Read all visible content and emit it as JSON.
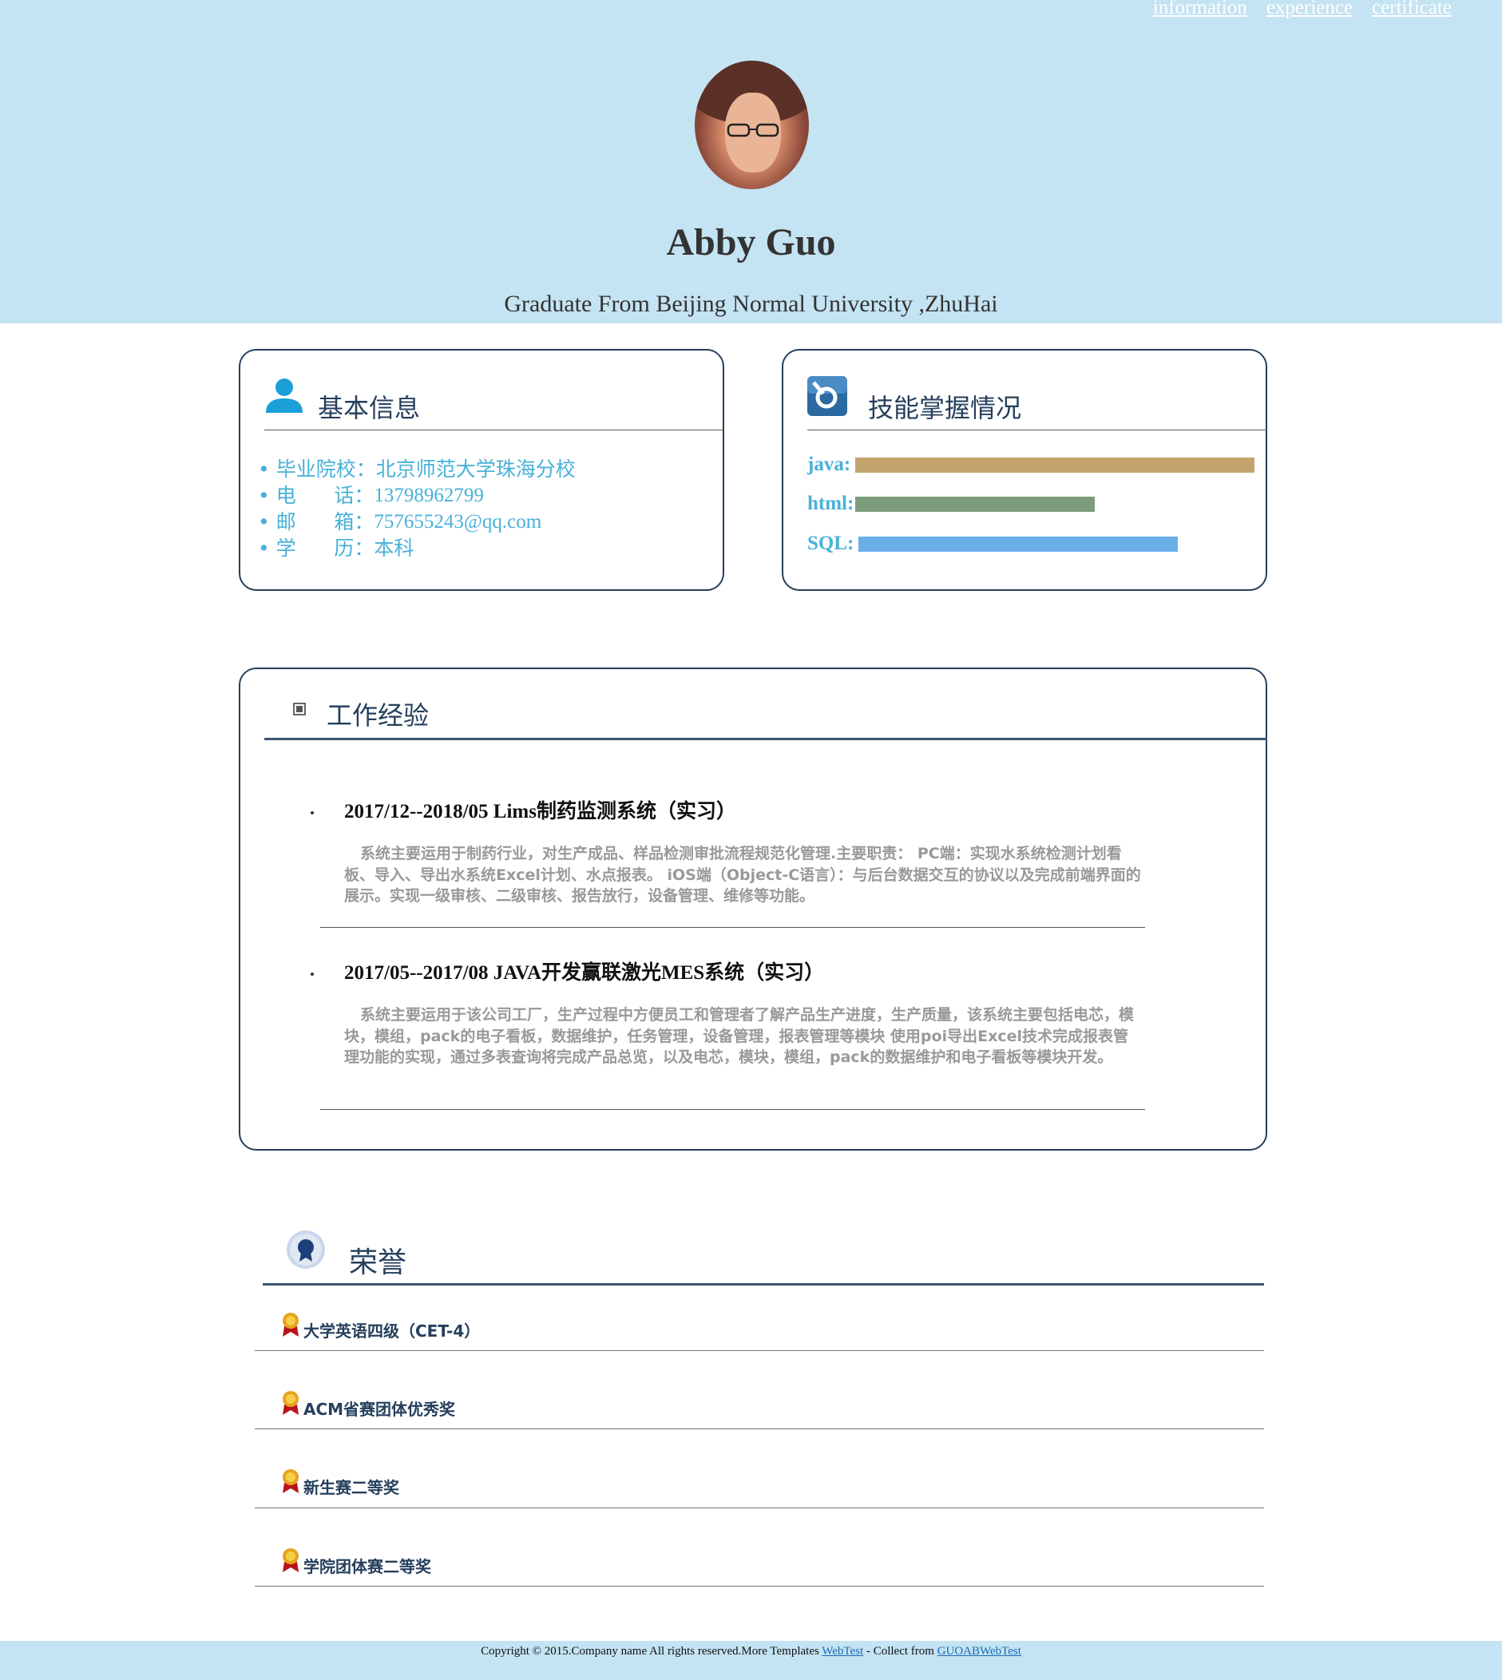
{
  "nav": {
    "items": [
      "information",
      "experience",
      "certificate"
    ]
  },
  "profile": {
    "name": "Abby Guo",
    "subtitle": "Graduate From Beijing Normal University ,ZhuHai"
  },
  "basic_info": {
    "title": "基本信息",
    "rows": [
      {
        "label": "• 毕业院校：",
        "value": "北京师范大学珠海分校"
      },
      {
        "label": "• 电      话：",
        "value": "13798962799"
      },
      {
        "label": "• 邮      箱：",
        "value": "757655243@qq.com"
      },
      {
        "label": "• 学      历：",
        "value": "本科"
      }
    ]
  },
  "skills": {
    "title": "技能掌握情况",
    "items": [
      {
        "label": "java:",
        "level": 1.0,
        "color": "#c3a46d"
      },
      {
        "label": "html:",
        "level": 0.6,
        "color": "#7c9c7e"
      },
      {
        "label": "SQL:",
        "level": 0.8,
        "color": "#6aaee8"
      }
    ]
  },
  "experience": {
    "title": "工作经验",
    "items": [
      {
        "title": "2017/12--2018/05 Lims制药监测系统（实习）",
        "desc": "系统主要运用于制药行业，对生产成品、样品检测审批流程规范化管理.主要职责： PC端：实现水系统检测计划看板、导入、导出水系统Excel计划、水点报表。 iOS端（Object-C语言）：与后台数据交互的协议以及完成前端界面的展示。实现一级审核、二级审核、报告放行，设备管理、维修等功能。"
      },
      {
        "title": "2017/05--2017/08 JAVA开发赢联激光MES系统（实习）",
        "desc": "系统主要运用于该公司工厂，生产过程中方便员工和管理者了解产品生产进度，生产质量，该系统主要包括电芯，模块，模组，pack的电子看板，数据维护，任务管理，设备管理，报表管理等模块 使用poi导出Excel技术完成报表管理功能的实现，通过多表查询将完成产品总览，以及电芯，模块，模组，pack的数据维护和电子看板等模块开发。"
      }
    ]
  },
  "honors": {
    "title": "荣誉",
    "items": [
      "大学英语四级（CET-4）",
      "ACM省赛团体优秀奖",
      "新生赛二等奖",
      "学院团体赛二等奖"
    ]
  },
  "footer": {
    "text": "Copyright © 2015.Company name All rights reserved.More Templates ",
    "link1": "WebTest",
    "middle": " - Collect from ",
    "link2": "GUOABWebTest"
  },
  "colors": {
    "header_bg": "#c4e3f3",
    "card_border": "#253f5c",
    "info_text": "#49b1d8"
  }
}
